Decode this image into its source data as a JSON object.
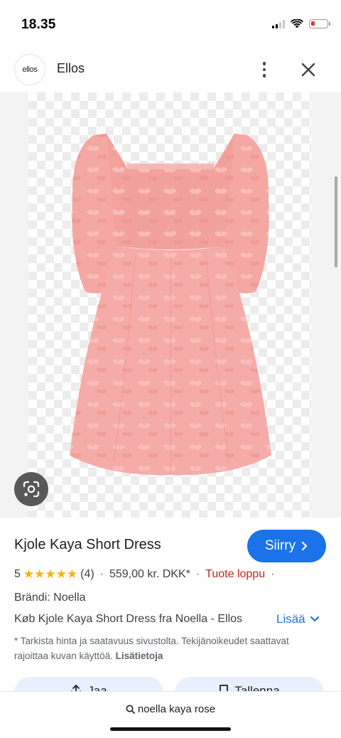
{
  "status_bar": {
    "time": "18.35"
  },
  "source": {
    "logo_text": "ellos",
    "name": "Ellos"
  },
  "product": {
    "title": "Kjole Kaya Short Dress",
    "visit_label": "Siirry",
    "rating_value": "5",
    "stars": "★★★★★",
    "review_count": "(4)",
    "price": "559,00 kr. DKK*",
    "stock_status": "Tuote loppu",
    "brand": "Brändi: Noella",
    "description": "Køb Kjole Kaya Short Dress fra Noella - Ellos",
    "more_label": "Lisää",
    "disclaimer_text": "* Tarkista hinta ja saatavuus sivustolta. Tekijänoikeudet saattavat rajoittaa kuvan käyttöä.",
    "disclaimer_link": "Lisätietoja"
  },
  "actions": {
    "share_label": "Jaa",
    "save_label": "Tallenna"
  },
  "search": {
    "query": "noella kaya rose"
  },
  "colors": {
    "accent": "#1a73e8",
    "star": "#f4b400",
    "out_of_stock": "#c5221f",
    "dress": "#f4a7a3"
  },
  "icons": {
    "close": "close-icon",
    "more": "more-vert-icon",
    "lens": "google-lens-icon",
    "search": "search-icon",
    "chevron": "chevron-right-icon",
    "expand": "chevron-down-icon"
  }
}
